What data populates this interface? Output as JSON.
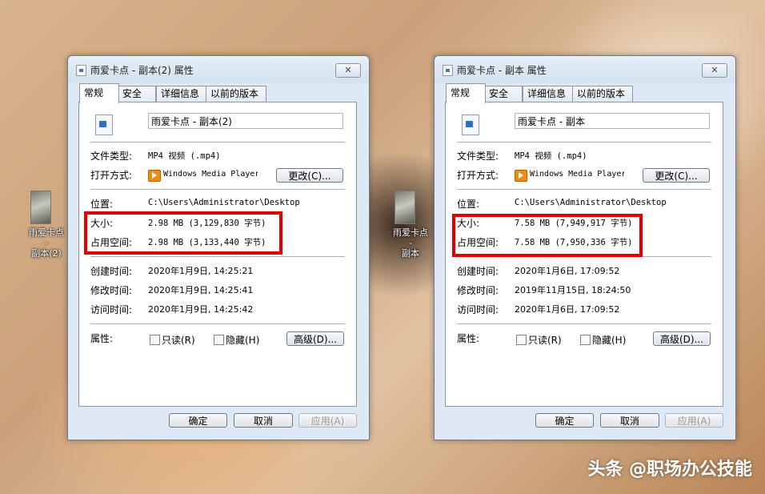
{
  "desktop": {
    "icons": [
      {
        "label": "雨爱卡点 -\n副本(2)"
      },
      {
        "label": "雨爱卡点 -\n副本"
      }
    ]
  },
  "watermark": "头条 @职场办公技能",
  "windows": [
    {
      "title": "雨爱卡点 - 副本(2) 属性",
      "close": "✕",
      "tabs": [
        "常规",
        "安全",
        "详细信息",
        "以前的版本"
      ],
      "file_name": "雨爱卡点 - 副本(2)",
      "labels": {
        "type": "文件类型:",
        "open_with": "打开方式:",
        "location": "位置:",
        "size": "大小:",
        "size_on_disk": "占用空间:",
        "created": "创建时间:",
        "modified": "修改时间:",
        "accessed": "访问时间:",
        "attributes": "属性:"
      },
      "file_type": "MP4 视频 (.mp4)",
      "open_with_app": "Windows Media Player",
      "change_button": "更改(C)...",
      "location": "C:\\Users\\Administrator\\Desktop",
      "size": "2.98 MB (3,129,830 字节)",
      "size_on_disk": "2.98 MB (3,133,440 字节)",
      "created": "2020年1月9日, 14:25:21",
      "modified": "2020年1月9日, 14:25:41",
      "accessed": "2020年1月9日, 14:25:42",
      "readonly_label": "只读(R)",
      "hidden_label": "隐藏(H)",
      "advanced_button": "高级(D)...",
      "ok_button": "确定",
      "cancel_button": "取消",
      "apply_button": "应用(A)"
    },
    {
      "title": "雨爱卡点 - 副本 属性",
      "close": "✕",
      "tabs": [
        "常规",
        "安全",
        "详细信息",
        "以前的版本"
      ],
      "file_name": "雨爱卡点 - 副本",
      "labels": {
        "type": "文件类型:",
        "open_with": "打开方式:",
        "location": "位置:",
        "size": "大小:",
        "size_on_disk": "占用空间:",
        "created": "创建时间:",
        "modified": "修改时间:",
        "accessed": "访问时间:",
        "attributes": "属性:"
      },
      "file_type": "MP4 视频 (.mp4)",
      "open_with_app": "Windows Media Player",
      "change_button": "更改(C)...",
      "location": "C:\\Users\\Administrator\\Desktop",
      "size": "7.58 MB (7,949,917 字节)",
      "size_on_disk": "7.58 MB (7,950,336 字节)",
      "created": "2020年1月6日, 17:09:52",
      "modified": "2019年11月15日, 18:24:50",
      "accessed": "2020年1月6日, 17:09:52",
      "readonly_label": "只读(R)",
      "hidden_label": "隐藏(H)",
      "advanced_button": "高级(D)...",
      "ok_button": "确定",
      "cancel_button": "取消",
      "apply_button": "应用(A)"
    }
  ]
}
